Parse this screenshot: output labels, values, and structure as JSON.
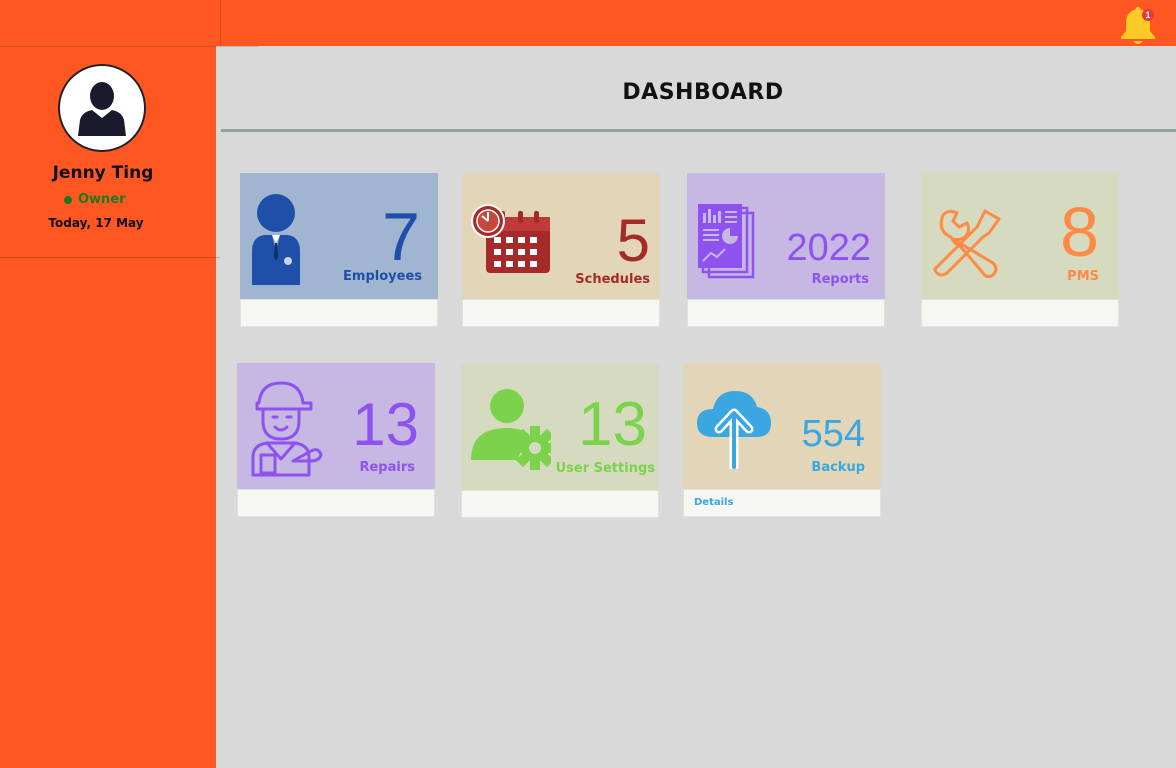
{
  "header": {
    "notification_count": "1"
  },
  "sidebar": {
    "user_name": "Jenny Ting",
    "user_role": "Owner",
    "date_text": "Today, 17 May"
  },
  "main": {
    "title": "DASHBOARD",
    "cards": [
      {
        "value": "7",
        "label": "Employees",
        "footer": "",
        "icon": "employee-icon",
        "bg": "#9fb5d0",
        "color": "#1f4fa8"
      },
      {
        "value": "5",
        "label": "Schedules",
        "footer": "",
        "icon": "calendar-clock-icon",
        "bg": "#e3d6b8",
        "color": "#a52b2b"
      },
      {
        "value": "2022",
        "label": "Reports",
        "footer": "",
        "icon": "report-icon",
        "bg": "#c6b7e3",
        "color": "#8e52ee"
      },
      {
        "value": "8",
        "label": "PMS",
        "footer": "",
        "icon": "tools-icon",
        "bg": "#d6dabf",
        "color": "#ff8a45"
      },
      {
        "value": "13",
        "label": "Repairs",
        "footer": "",
        "icon": "mechanic-icon",
        "bg": "#c6b7e3",
        "color": "#8e52ee"
      },
      {
        "value": "13",
        "label": "User Settings",
        "footer": "",
        "icon": "user-settings-icon",
        "bg": "#d6dabf",
        "color": "#7bd34c"
      },
      {
        "value": "554",
        "label": "Backup",
        "footer": "Details",
        "icon": "cloud-upload-icon",
        "bg": "#e3d6b8",
        "color": "#3aa7e0"
      }
    ]
  }
}
